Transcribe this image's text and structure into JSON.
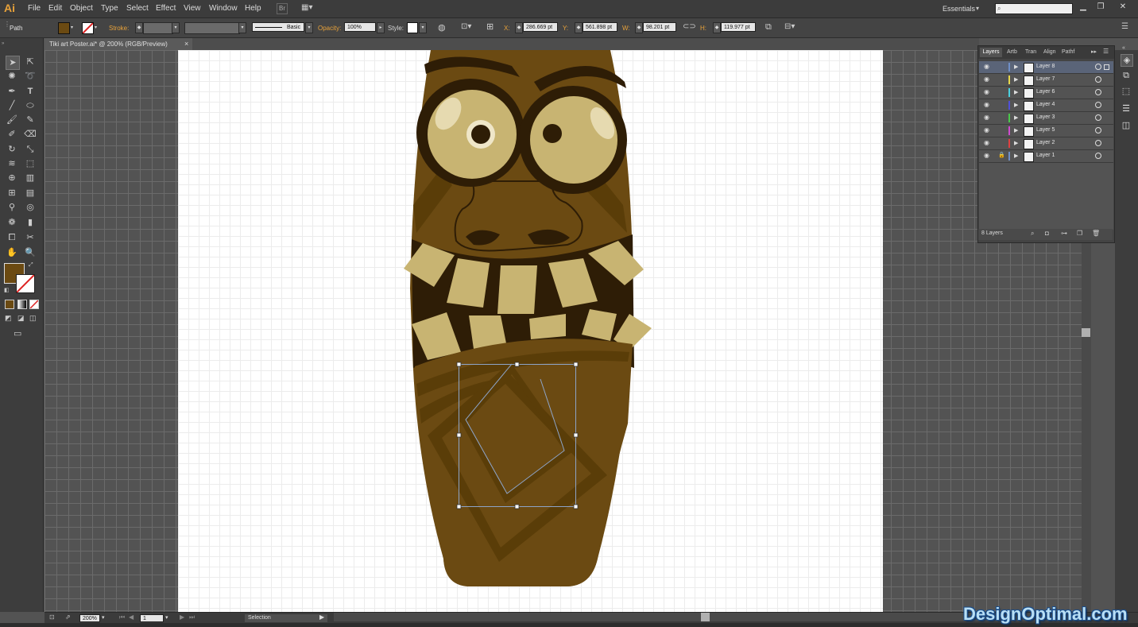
{
  "app": {
    "logo": "Ai"
  },
  "menu": [
    "File",
    "Edit",
    "Object",
    "Type",
    "Select",
    "Effect",
    "View",
    "Window",
    "Help"
  ],
  "workspace": "Essentials",
  "control": {
    "object_type": "Path",
    "stroke_label": "Stroke:",
    "brush_label": "Basic",
    "opacity_label": "Opacity:",
    "opacity_value": "100%",
    "style_label": "Style:",
    "x_label": "X:",
    "x_value": "286.669 pt",
    "y_label": "Y:",
    "y_value": "561.898 pt",
    "w_label": "W:",
    "w_value": "98.201 pt",
    "h_label": "H:",
    "h_value": "119.977 pt",
    "fill_color": "#6b4a12"
  },
  "document": {
    "tab_title": "Tiki art Poster.ai* @ 200% (RGB/Preview)",
    "close": "×"
  },
  "layers_panel": {
    "tabs": [
      "Layers",
      "Artb",
      "Tran",
      "Align",
      "Pathf"
    ],
    "layers": [
      {
        "name": "Layer 8",
        "color": "#6f8fc7",
        "selected": true,
        "locked": false
      },
      {
        "name": "Layer 7",
        "color": "#e8d84a",
        "selected": false,
        "locked": false
      },
      {
        "name": "Layer 6",
        "color": "#4ad0e0",
        "selected": false,
        "locked": false
      },
      {
        "name": "Layer 4",
        "color": "#5050d8",
        "selected": false,
        "locked": false
      },
      {
        "name": "Layer 3",
        "color": "#4ac84a",
        "selected": false,
        "locked": false
      },
      {
        "name": "Layer 5",
        "color": "#d04ad0",
        "selected": false,
        "locked": false
      },
      {
        "name": "Layer 2",
        "color": "#e04040",
        "selected": false,
        "locked": false
      },
      {
        "name": "Layer 1",
        "color": "#6f8fc7",
        "selected": false,
        "locked": true
      }
    ],
    "count": "8 Layers"
  },
  "status": {
    "zoom": "200%",
    "page": "1",
    "tool": "Selection"
  },
  "watermark": "DesignOptimal.com",
  "tiki_colors": {
    "body": "#6b4a12",
    "dark": "#2e1d06",
    "mid": "#5a3d08",
    "teeth": "#c8b472",
    "eye": "#c8b472"
  }
}
